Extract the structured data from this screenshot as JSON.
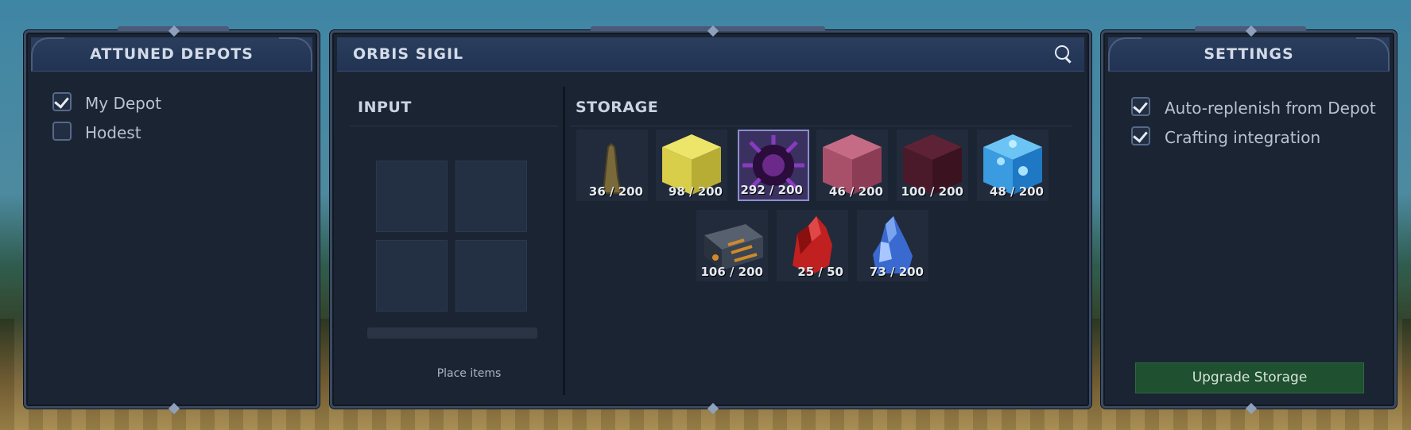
{
  "depots_panel": {
    "title": "ATTUNED DEPOTS",
    "items": [
      {
        "label": "My Depot",
        "checked": true
      },
      {
        "label": "Hodest",
        "checked": false
      }
    ]
  },
  "main_panel": {
    "title": "ORBIS SIGIL",
    "search_icon": "search-icon",
    "input": {
      "title": "INPUT",
      "hint": "Place items"
    },
    "storage": {
      "title": "STORAGE",
      "items": [
        {
          "icon": "spire-icon",
          "quantity": "36 / 200",
          "color": "#7a6a3a",
          "selected": false
        },
        {
          "icon": "yellow-block-icon",
          "quantity": "98 / 200",
          "color": "#d8ce4a",
          "selected": false
        },
        {
          "icon": "purple-crystal-icon",
          "quantity": "292 / 200",
          "color": "#6b2a8a",
          "selected": true
        },
        {
          "icon": "pink-block-icon",
          "quantity": "46 / 200",
          "color": "#a8506a",
          "selected": false
        },
        {
          "icon": "maroon-block-icon",
          "quantity": "100 / 200",
          "color": "#4a1a2a",
          "selected": false
        },
        {
          "icon": "ice-block-icon",
          "quantity": "48 / 200",
          "color": "#3a9be0",
          "selected": false
        },
        {
          "icon": "chest-icon",
          "quantity": "106 / 200",
          "color": "#3a4452",
          "selected": false
        },
        {
          "icon": "red-crystal-icon",
          "quantity": "25 / 50",
          "color": "#c02020",
          "selected": false
        },
        {
          "icon": "blue-crystal-icon",
          "quantity": "73 / 200",
          "color": "#3a6ad0",
          "selected": false
        }
      ]
    }
  },
  "settings_panel": {
    "title": "SETTINGS",
    "options": [
      {
        "label": "Auto-replenish from Depot",
        "checked": true
      },
      {
        "label": "Crafting integration",
        "checked": true
      }
    ],
    "upgrade_button": "Upgrade Storage"
  }
}
